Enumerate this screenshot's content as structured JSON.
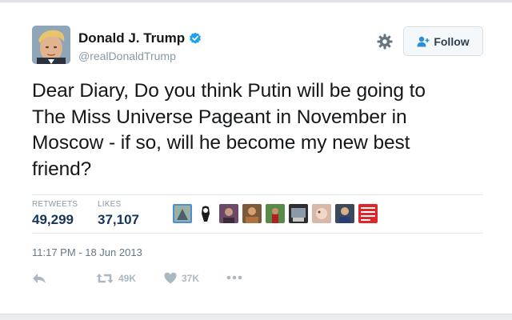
{
  "author": {
    "display_name": "Donald J. Trump",
    "handle": "@realDonaldTrump",
    "verified": true
  },
  "follow_button": {
    "label": "Follow"
  },
  "tweet": {
    "lines": [
      "Dear Diary, Do you think Putin will be going to",
      "The Miss Universe Pageant in November in",
      "Moscow - if so, will he become my new best",
      "friend?"
    ]
  },
  "stats": {
    "retweets_label": "RETWEETS",
    "retweets_value": "49,299",
    "likes_label": "LIKES",
    "likes_value": "37,107"
  },
  "timestamp": "11:17 PM - 18 Jun 2013",
  "actions": {
    "retweet_count": "49K",
    "like_count": "37K"
  },
  "colors": {
    "link_blue": "#2a6496",
    "muted": "#8899a6",
    "verified_blue": "#1da1f2",
    "poster_red": "#e0262a"
  },
  "icons": [
    "settings-icon",
    "follow-user-icon",
    "verified-badge-icon",
    "reply-icon",
    "retweet-icon",
    "heart-icon",
    "more-icon"
  ]
}
